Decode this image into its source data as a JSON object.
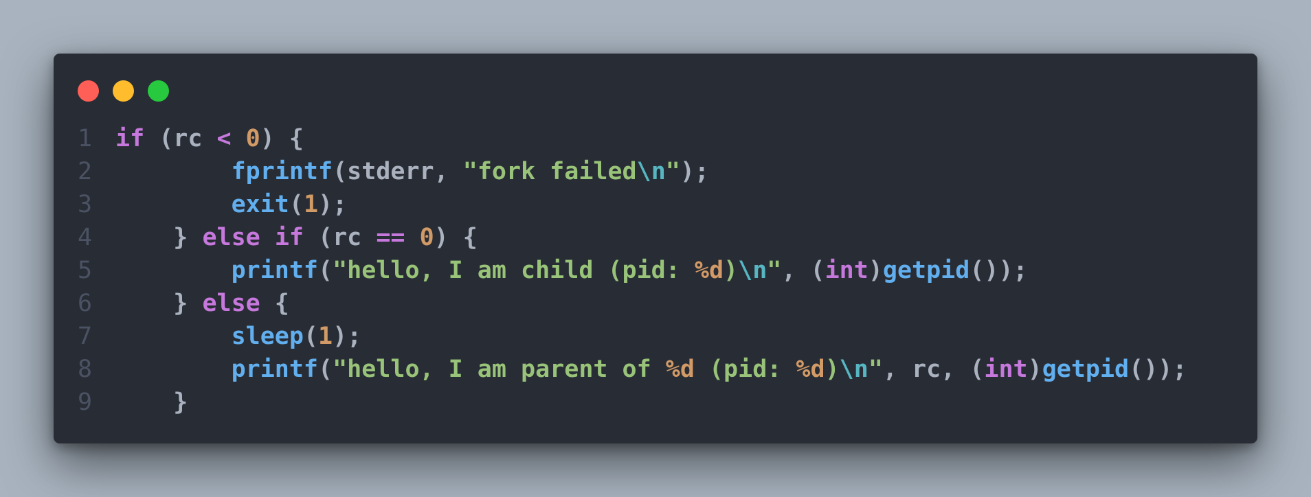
{
  "window": {
    "controls": {
      "close_color": "#ff5f56",
      "minimize_color": "#ffbd2e",
      "maximize_color": "#27c93f"
    }
  },
  "code": {
    "lines": [
      {
        "number": "1",
        "tokens": [
          {
            "t": "k",
            "v": "if"
          },
          {
            "t": "p",
            "v": " (rc "
          },
          {
            "t": "k",
            "v": "<"
          },
          {
            "t": "p",
            "v": " "
          },
          {
            "t": "n",
            "v": "0"
          },
          {
            "t": "p",
            "v": ") {"
          }
        ]
      },
      {
        "number": "2",
        "tokens": [
          {
            "t": "p",
            "v": "        "
          },
          {
            "t": "f",
            "v": "fprintf"
          },
          {
            "t": "p",
            "v": "(stderr, "
          },
          {
            "t": "s",
            "v": "\"fork failed"
          },
          {
            "t": "e",
            "v": "\\n"
          },
          {
            "t": "s",
            "v": "\""
          },
          {
            "t": "p",
            "v": ");"
          }
        ]
      },
      {
        "number": "3",
        "tokens": [
          {
            "t": "p",
            "v": "        "
          },
          {
            "t": "f",
            "v": "exit"
          },
          {
            "t": "p",
            "v": "("
          },
          {
            "t": "n",
            "v": "1"
          },
          {
            "t": "p",
            "v": ");"
          }
        ]
      },
      {
        "number": "4",
        "tokens": [
          {
            "t": "p",
            "v": "    } "
          },
          {
            "t": "k",
            "v": "else"
          },
          {
            "t": "p",
            "v": " "
          },
          {
            "t": "k",
            "v": "if"
          },
          {
            "t": "p",
            "v": " (rc "
          },
          {
            "t": "k",
            "v": "=="
          },
          {
            "t": "p",
            "v": " "
          },
          {
            "t": "n",
            "v": "0"
          },
          {
            "t": "p",
            "v": ") {"
          }
        ]
      },
      {
        "number": "5",
        "tokens": [
          {
            "t": "p",
            "v": "        "
          },
          {
            "t": "f",
            "v": "printf"
          },
          {
            "t": "p",
            "v": "("
          },
          {
            "t": "s",
            "v": "\"hello, I am child (pid: "
          },
          {
            "t": "n",
            "v": "%d"
          },
          {
            "t": "s",
            "v": ")"
          },
          {
            "t": "e",
            "v": "\\n"
          },
          {
            "t": "s",
            "v": "\""
          },
          {
            "t": "p",
            "v": ", ("
          },
          {
            "t": "k",
            "v": "int"
          },
          {
            "t": "p",
            "v": ")"
          },
          {
            "t": "f",
            "v": "getpid"
          },
          {
            "t": "p",
            "v": "());"
          }
        ]
      },
      {
        "number": "6",
        "tokens": [
          {
            "t": "p",
            "v": "    } "
          },
          {
            "t": "k",
            "v": "else"
          },
          {
            "t": "p",
            "v": " {"
          }
        ]
      },
      {
        "number": "7",
        "tokens": [
          {
            "t": "p",
            "v": "        "
          },
          {
            "t": "f",
            "v": "sleep"
          },
          {
            "t": "p",
            "v": "("
          },
          {
            "t": "n",
            "v": "1"
          },
          {
            "t": "p",
            "v": ");"
          }
        ]
      },
      {
        "number": "8",
        "tokens": [
          {
            "t": "p",
            "v": "        "
          },
          {
            "t": "f",
            "v": "printf"
          },
          {
            "t": "p",
            "v": "("
          },
          {
            "t": "s",
            "v": "\"hello, I am parent of "
          },
          {
            "t": "n",
            "v": "%d"
          },
          {
            "t": "s",
            "v": " (pid: "
          },
          {
            "t": "n",
            "v": "%d"
          },
          {
            "t": "s",
            "v": ")"
          },
          {
            "t": "e",
            "v": "\\n"
          },
          {
            "t": "s",
            "v": "\""
          },
          {
            "t": "p",
            "v": ", rc, ("
          },
          {
            "t": "k",
            "v": "int"
          },
          {
            "t": "p",
            "v": ")"
          },
          {
            "t": "f",
            "v": "getpid"
          },
          {
            "t": "p",
            "v": "());"
          }
        ]
      },
      {
        "number": "9",
        "tokens": [
          {
            "t": "p",
            "v": "    }"
          }
        ]
      }
    ]
  }
}
